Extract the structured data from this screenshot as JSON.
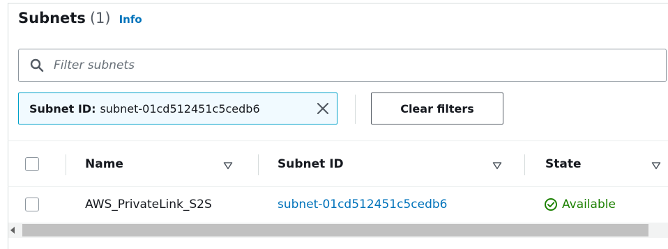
{
  "header": {
    "title": "Subnets",
    "count": "(1)",
    "info_link": "Info"
  },
  "search": {
    "placeholder": "Filter subnets",
    "value": ""
  },
  "filter_token": {
    "key": "Subnet ID:",
    "value": "subnet-01cd512451c5cedb6"
  },
  "clear_filters_label": "Clear filters",
  "table": {
    "columns": [
      {
        "label": "Name"
      },
      {
        "label": "Subnet ID"
      },
      {
        "label": "State"
      }
    ],
    "rows": [
      {
        "name": "AWS_PrivateLink_S2S",
        "subnet_id": "subnet-01cd512451c5cedb6",
        "state": "Available"
      }
    ]
  },
  "colors": {
    "link": "#0073bb",
    "available": "#1d8102",
    "token_border": "#00a1c9",
    "token_bg": "#f1faff"
  },
  "icons": {
    "search": "search-icon",
    "close": "close-icon",
    "sort": "sort-down-icon",
    "status": "check-circle-icon"
  }
}
